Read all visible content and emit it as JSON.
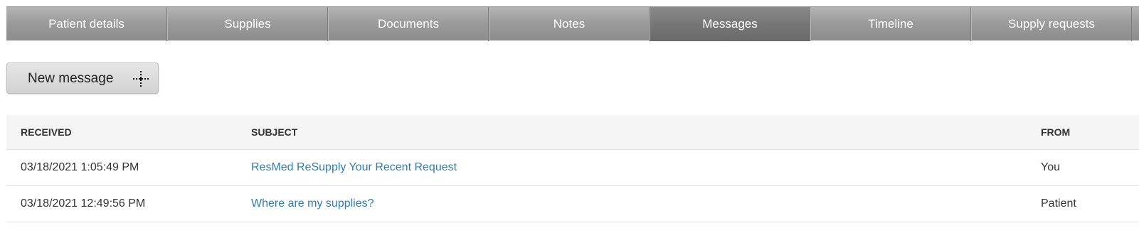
{
  "tabs": [
    {
      "label": "Patient details"
    },
    {
      "label": "Supplies"
    },
    {
      "label": "Documents"
    },
    {
      "label": "Notes"
    },
    {
      "label": "Messages",
      "active": true
    },
    {
      "label": "Timeline"
    },
    {
      "label": "Supply requests"
    }
  ],
  "toolbar": {
    "new_message_label": "New message",
    "new_message_icon": "dotted-plus-icon"
  },
  "table": {
    "headers": {
      "received": "RECEIVED",
      "subject": "SUBJECT",
      "from": "FROM"
    },
    "rows": [
      {
        "received": "03/18/2021 1:05:49 PM",
        "subject": "ResMed ReSupply Your Recent Request",
        "from": "You"
      },
      {
        "received": "03/18/2021 12:49:56 PM",
        "subject": "Where are my supplies?",
        "from": "Patient"
      }
    ]
  },
  "colors": {
    "link": "#2e7db5",
    "tab_text": "#ffffff",
    "header_bg": "#f5f5f5"
  }
}
